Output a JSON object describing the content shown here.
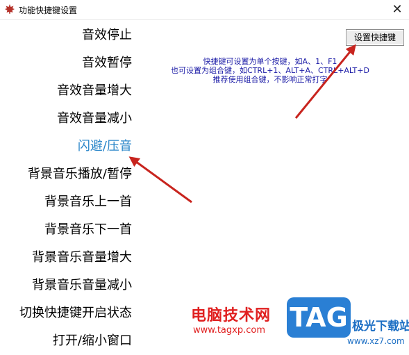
{
  "window": {
    "title": "功能快捷键设置",
    "close_symbol": "✕"
  },
  "actions": [
    {
      "label": "音效停止",
      "active": false
    },
    {
      "label": "音效暂停",
      "active": false
    },
    {
      "label": "音效音量增大",
      "active": false
    },
    {
      "label": "音效音量减小",
      "active": false
    },
    {
      "label": "闪避/压音",
      "active": true
    },
    {
      "label": "背景音乐播放/暂停",
      "active": false
    },
    {
      "label": "背景音乐上一首",
      "active": false
    },
    {
      "label": "背景音乐下一首",
      "active": false
    },
    {
      "label": "背景音乐音量增大",
      "active": false
    },
    {
      "label": "背景音乐音量减小",
      "active": false
    },
    {
      "label": "切换快捷键开启状态",
      "active": false
    },
    {
      "label": "打开/缩小窗口",
      "active": false
    }
  ],
  "set_button": {
    "label": "设置快捷键"
  },
  "hint": {
    "line1": "快捷键可设置为单个按键，如A、1、F1",
    "line2": "也可设置为组合键，如CTRL+1、ALT+A、CTRL+ALT+D",
    "line3": "推荐使用组合键，不影响正常打字"
  },
  "watermark": {
    "brand": "电脑技术网",
    "url": "www.tagxp.com",
    "tag": "TAG",
    "site": "极光下载站",
    "site_url": "www.xz7.com"
  },
  "colors": {
    "active": "#2a86c9",
    "hint": "#1a1aa6",
    "arrow": "#c8241e",
    "watermark_red": "#e02020",
    "watermark_blue": "#2a7fd4"
  },
  "icons": {
    "app": "maple-leaf-icon",
    "close": "close-icon"
  }
}
